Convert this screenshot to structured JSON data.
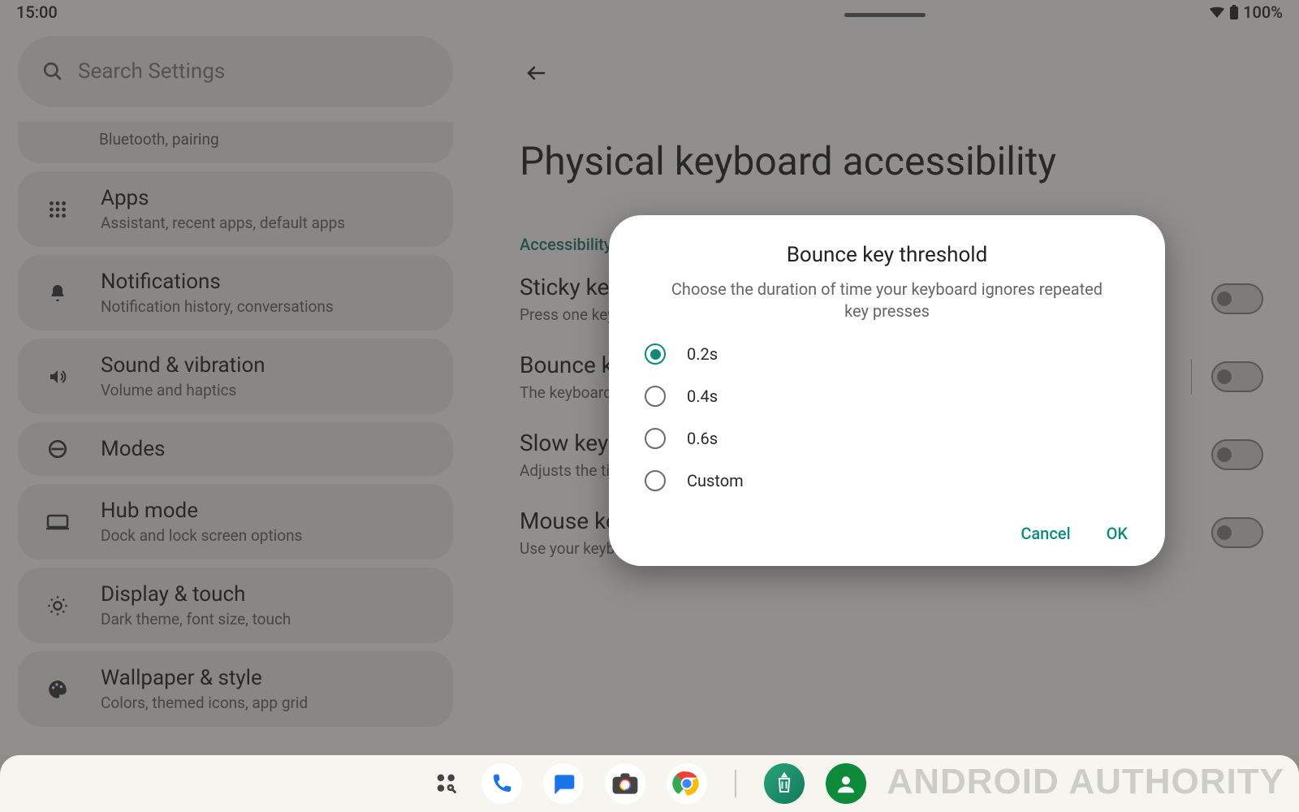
{
  "status": {
    "time": "15:00",
    "battery": "100%"
  },
  "search": {
    "placeholder": "Search Settings"
  },
  "sidebar": {
    "partial_sub": "Bluetooth, pairing",
    "items": [
      {
        "title": "Apps",
        "sub": "Assistant, recent apps, default apps"
      },
      {
        "title": "Notifications",
        "sub": "Notification history, conversations"
      },
      {
        "title": "Sound & vibration",
        "sub": "Volume and haptics"
      },
      {
        "title": "Modes",
        "sub": ""
      },
      {
        "title": "Hub mode",
        "sub": "Dock and lock screen options"
      },
      {
        "title": "Display & touch",
        "sub": "Dark theme, font size, touch"
      },
      {
        "title": "Wallpaper & style",
        "sub": "Colors, themed icons, app grid"
      }
    ]
  },
  "page": {
    "title": "Physical keyboard accessibility",
    "breadcrumb": "Accessibility",
    "options": [
      {
        "title": "Sticky keys",
        "sub": "Press one key at a",
        "has_divider": false
      },
      {
        "title": "Bounce keys",
        "sub": "The keyboard ign",
        "has_divider": true
      },
      {
        "title": "Slow keys",
        "sub": "Adjusts the time i",
        "has_divider": false
      },
      {
        "title": "Mouse keys",
        "sub": "Use your keyboard to control the pointer",
        "has_divider": false
      }
    ]
  },
  "dialog": {
    "title": "Bounce key threshold",
    "desc": "Choose the duration of time your keyboard ignores repeated key presses",
    "options": [
      "0.2s",
      "0.4s",
      "0.6s",
      "Custom"
    ],
    "selected_index": 0,
    "cancel": "Cancel",
    "ok": "OK"
  },
  "watermark": "ANDROID AUTHORITY"
}
